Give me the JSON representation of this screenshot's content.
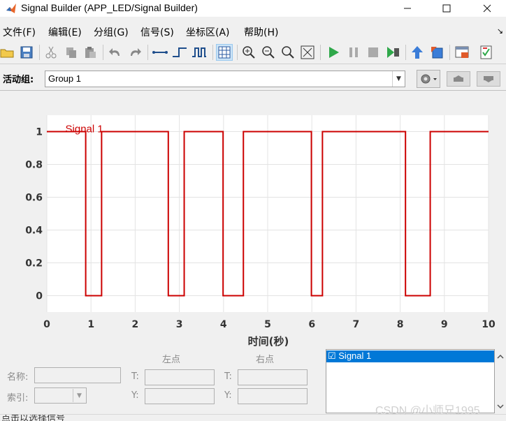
{
  "window": {
    "title": "Signal Builder (APP_LED/Signal Builder)"
  },
  "menu": [
    "文件(F)",
    "编辑(E)",
    "分组(G)",
    "信号(S)",
    "坐标区(A)",
    "帮助(H)"
  ],
  "group": {
    "label": "活动组:",
    "selected": "Group 1"
  },
  "colors": {
    "signal": "#cc0000",
    "selection": "#0078d7"
  },
  "chart_data": {
    "type": "line",
    "xlabel": "时间(秒)",
    "xlim": [
      0,
      10
    ],
    "ylim": [
      -0.1,
      1.1
    ],
    "xticks": [
      "0",
      "1",
      "2",
      "3",
      "4",
      "5",
      "6",
      "7",
      "8",
      "9",
      "10"
    ],
    "yticks": [
      "0",
      "0.2",
      "0.4",
      "0.6",
      "0.8",
      "1"
    ],
    "grid": true,
    "series": [
      {
        "name": "Signal 1",
        "x": [
          0,
          0.88,
          0.88,
          1.24,
          1.24,
          2.75,
          2.75,
          3.11,
          3.11,
          3.99,
          3.99,
          4.45,
          4.45,
          5.99,
          5.99,
          6.24,
          6.24,
          8.12,
          8.12,
          8.68,
          8.68,
          10
        ],
        "y": [
          1,
          1,
          0,
          0,
          1,
          1,
          0,
          0,
          1,
          1,
          0,
          0,
          1,
          1,
          0,
          0,
          1,
          1,
          0,
          0,
          1,
          1
        ]
      }
    ]
  },
  "point_panel": {
    "name_label": "名称:",
    "index_label": "索引:",
    "left_header": "左点",
    "right_header": "右点",
    "t_label": "T:",
    "y_label": "Y:"
  },
  "signals": [
    {
      "label": "☑ Signal 1"
    }
  ],
  "watermark": "CSDN @小师兄1995",
  "status": "点击以选择信号"
}
